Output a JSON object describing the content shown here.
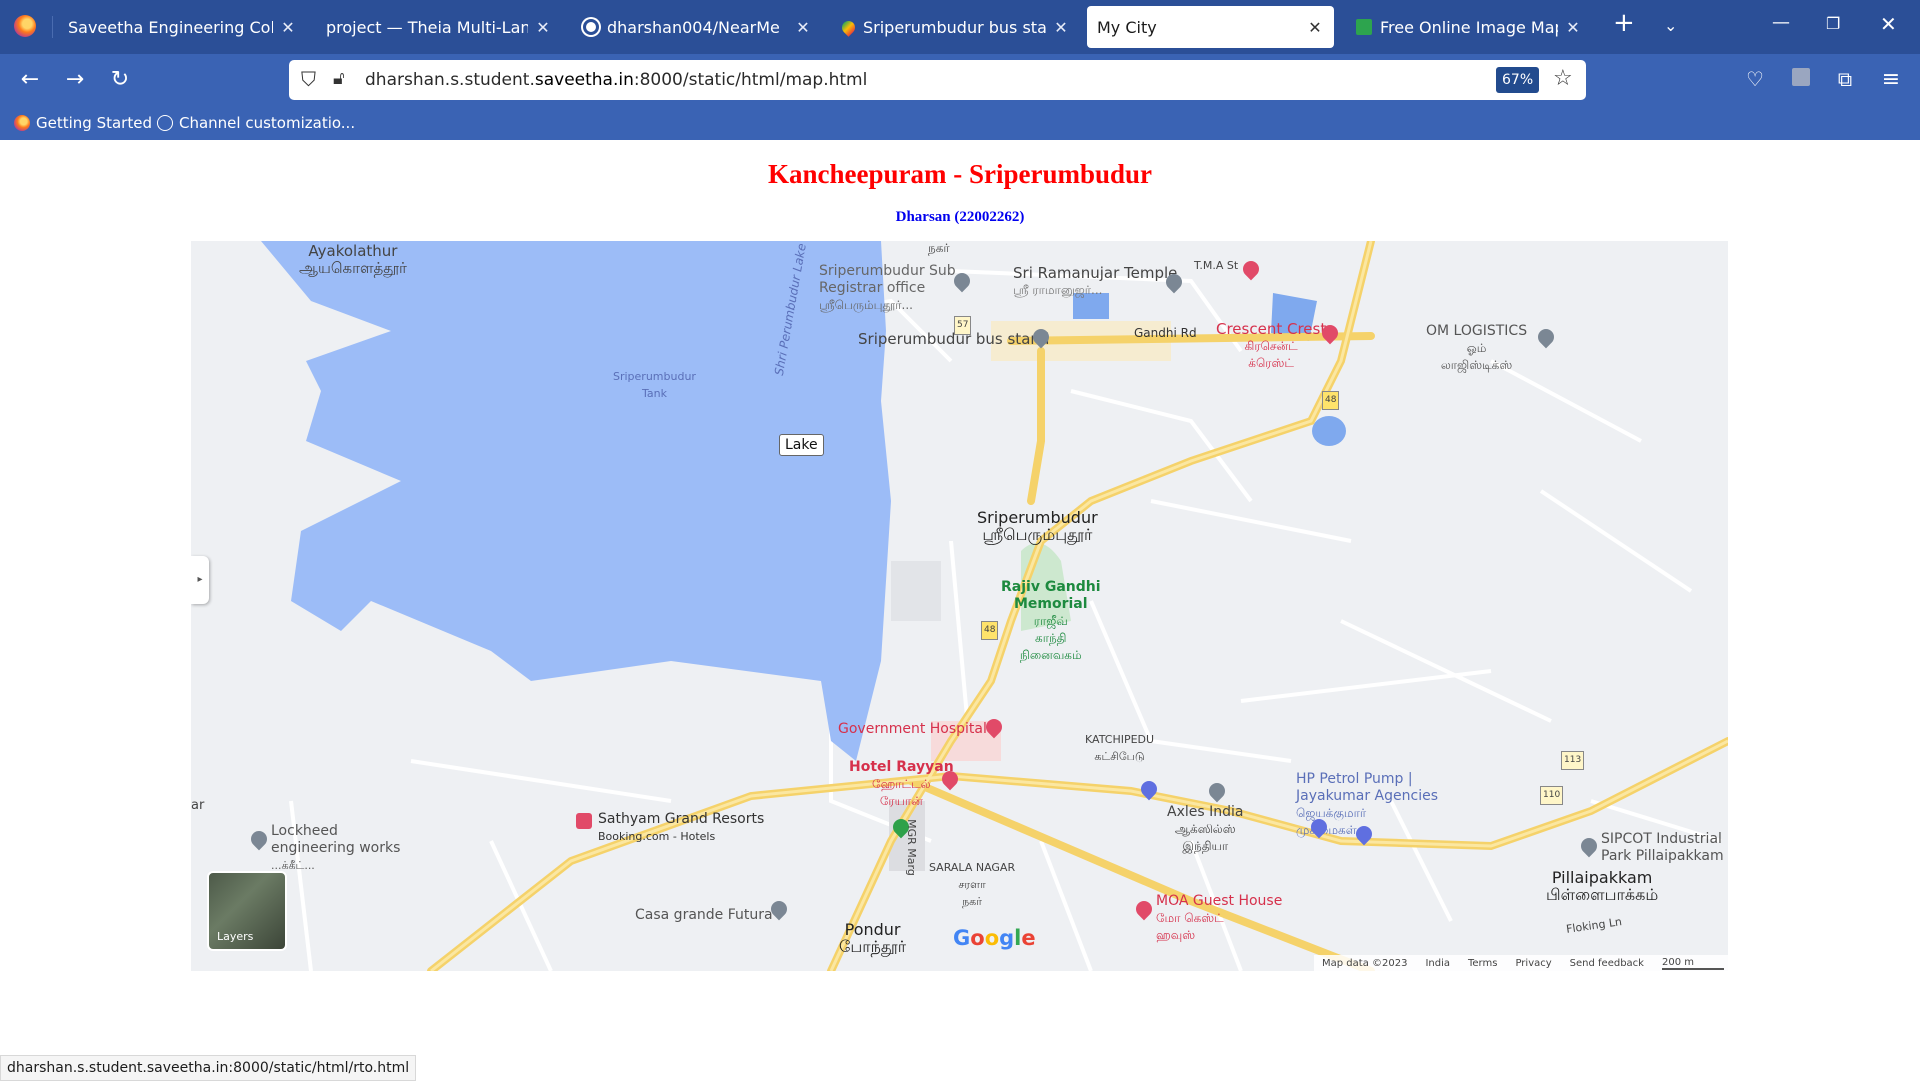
{
  "tabs": [
    {
      "label": "Saveetha Engineering College",
      "active": false,
      "close": "✕"
    },
    {
      "label": "project — Theia Multi-Language",
      "active": false,
      "close": "✕"
    },
    {
      "label": "dharshan004/NearMe",
      "active": false,
      "close": "✕"
    },
    {
      "label": "Sriperumbudur bus stand - G",
      "active": false,
      "close": "✕"
    },
    {
      "label": "My City",
      "active": true,
      "close": "✕"
    },
    {
      "label": "Free Online Image Map Gen",
      "active": false,
      "close": "✕"
    }
  ],
  "navbar": {
    "url_prefix": "dharshan.s.student.",
    "url_domain": "saveetha.in",
    "url_suffix": ":8000/static/html/map.html",
    "zoom": "67%"
  },
  "bookmarks": [
    {
      "label": "Getting Started",
      "icon": "firefox-icon"
    },
    {
      "label": "Channel customizatio...",
      "icon": "globe-icon"
    }
  ],
  "page": {
    "title": "Kancheepuram - Sriperumbudur",
    "subtitle": "Dharsan (22002262)"
  },
  "map": {
    "lake_tag": "Lake",
    "labels": {
      "ayakolathur": "Ayakolathur",
      "ayakolathur_ta": "ஆயகொளத்தூர்",
      "lake_name": "Shri Perumbudur Lake",
      "tank": "Sriperumbudur",
      "tank2": "Tank",
      "sub_registrar": "Sriperumbudur Sub",
      "sub_registrar2": "Registrar office",
      "sub_registrar_ta": "ஸ்ரீபெரும்புதூர்...",
      "temple": "Sri Ramanujar Temple",
      "temple_ta": "ஸ்ரீ ராமானுஜர்...",
      "tmast": "T.M.A St",
      "crescent": "Crescent Crest",
      "crescent_ta": "கிரசென்ட்",
      "crescent_ta2": "க்ரெஸ்ட்",
      "om_logistics": "OM LOGISTICS",
      "om_ta": "ஓம்",
      "om_ta2": "லாஜிஸ்டிக்ஸ்",
      "bus_stand": "Sriperumbudur bus stand",
      "gandhi_rd": "Gandhi Rd",
      "town": "Sriperumbudur",
      "town_ta": "ஸ்ரீபெரும்புதூர்",
      "memorial": "Rajiv Gandhi",
      "memorial2": "Memorial",
      "memorial_ta": "ராஜீவ்",
      "memorial_ta2": "காந்தி",
      "memorial_ta3": "நினைவகம்",
      "hospital": "Government Hospital",
      "katchipedu": "KATCHIPEDU",
      "katchipedu_ta": "கட்சிபேடு",
      "hotel": "Hotel Rayyan",
      "hotel_ta": "ஹோட்டல்",
      "hotel_ta2": "ரேயான்",
      "hp_petrol": "HP Petrol Pump |",
      "hp_petrol2": "Jayakumar Agencies",
      "hp_petrol_ta": "ஜெயக்குமார்",
      "hp_petrol_ta2": "முகமைகள்",
      "axles": "Axles India",
      "axles_ta": "ஆக்ஸில்ஸ்",
      "axles_ta2": "இந்தியா",
      "sathyam": "Sathyam Grand Resorts",
      "booking": "Booking.com - Hotels",
      "lockheed": "Lockheed",
      "lockheed2": "engineering works",
      "lockheed_ta": "...க்கீட்...",
      "mgr_marg": "MGR Marg",
      "sarala": "SARALA NAGAR",
      "sarala_ta": "சரளா",
      "sarala_ta2": "நகர்",
      "casa": "Casa grande Futura",
      "pondur": "Pondur",
      "pondur_ta": "போந்தூர்",
      "moa": "MOA Guest House",
      "moa_ta": "மோ கெஸ்ட்",
      "moa_ta2": "ஹவுஸ்",
      "sipcot": "SIPCOT Industrial",
      "sipcot2": "Park Pillaipakkam",
      "pillaipakkam": "Pillaipakkam",
      "pillaipakkam_ta": "பிள்ளைபாக்கம்",
      "flokingln": "Floking Ln",
      "nagar_top": "நகர்",
      "ar": "ar",
      "route57": "57",
      "route48a": "48",
      "route48b": "48",
      "route113": "113",
      "route110": "110"
    },
    "layers_label": "Layers",
    "google": "Google",
    "attribution": [
      "Map data ©2023",
      "India",
      "Terms",
      "Privacy",
      "Send feedback",
      "200 m"
    ]
  },
  "status_link": "dharshan.s.student.saveetha.in:8000/static/html/rto.html",
  "colors": {
    "tabbar": "#2b4f97",
    "navbar": "#3a63b4",
    "title": "#ff0000",
    "subtitle": "#0000ee",
    "lake": "#9cbcf7",
    "road": "#f5d26a"
  }
}
